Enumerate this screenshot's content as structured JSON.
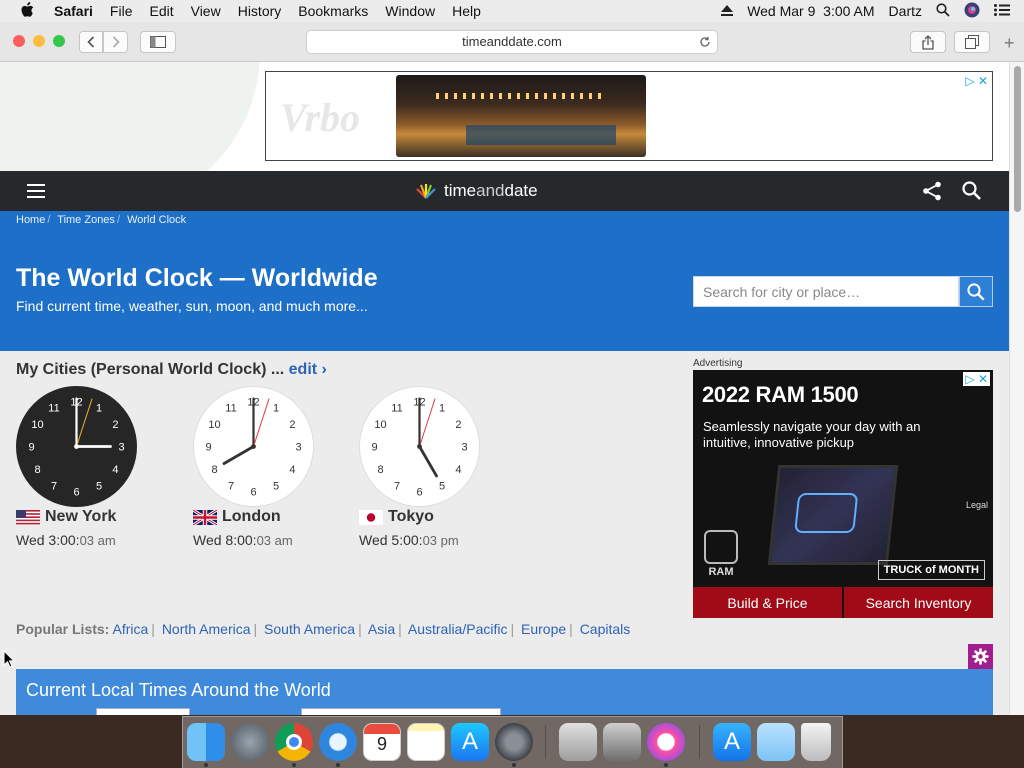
{
  "menubar": {
    "app": "Safari",
    "items": [
      "File",
      "Edit",
      "View",
      "History",
      "Bookmarks",
      "Window",
      "Help"
    ],
    "datetime": "Wed Mar 9  3:00 AM",
    "user": "Dartz"
  },
  "browser": {
    "url": "timeanddate.com"
  },
  "top_ad": {
    "brand": "Vrbo"
  },
  "site": {
    "logo_text_a": "time",
    "logo_text_b": "and",
    "logo_text_c": "date"
  },
  "breadcrumb": [
    "Home",
    "Time Zones",
    "World Clock"
  ],
  "hero": {
    "title": "The World Clock — Worldwide",
    "subtitle": "Find current time, weather, sun, moon, and much more...",
    "search_placeholder": "Search for city or place…"
  },
  "my_cities": {
    "heading": "My Cities (Personal World Clock) ...",
    "edit_label": "edit ›",
    "cities": [
      {
        "name": "New York",
        "time_main": "Wed 3:00:",
        "time_small": "03 am",
        "flag": "us-flag",
        "hour": 3,
        "minute": 0,
        "second": 3,
        "dark": true
      },
      {
        "name": "London",
        "time_main": "Wed 8:00:",
        "time_small": "03 am",
        "flag": "uk-flag",
        "hour": 8,
        "minute": 0,
        "second": 3,
        "dark": false
      },
      {
        "name": "Tokyo",
        "time_main": "Wed 5:00:",
        "time_small": "03 pm",
        "flag": "japan-flag",
        "hour": 5,
        "minute": 0,
        "second": 3,
        "dark": false
      }
    ]
  },
  "popular": {
    "label": "Popular Lists:",
    "links": [
      "Africa",
      "North America",
      "South America",
      "Asia",
      "Australia/Pacific",
      "Europe",
      "Capitals"
    ]
  },
  "side_ad": {
    "label": "Advertising",
    "title": "2022 RAM 1500",
    "text": "Seamlessly navigate your day with an intuitive, innovative pickup",
    "legal": "Legal",
    "brand": "RAM",
    "badge": "TRUCK of MONTH",
    "btn1": "Build & Price",
    "btn2": "Search Inventory"
  },
  "local_times": {
    "title": "Current Local Times Around the World"
  },
  "colors": {
    "hero_blue": "#1e6fc7",
    "header_dark": "#25292c",
    "link_blue": "#2d64b3",
    "ram_red": "#a10a17"
  }
}
